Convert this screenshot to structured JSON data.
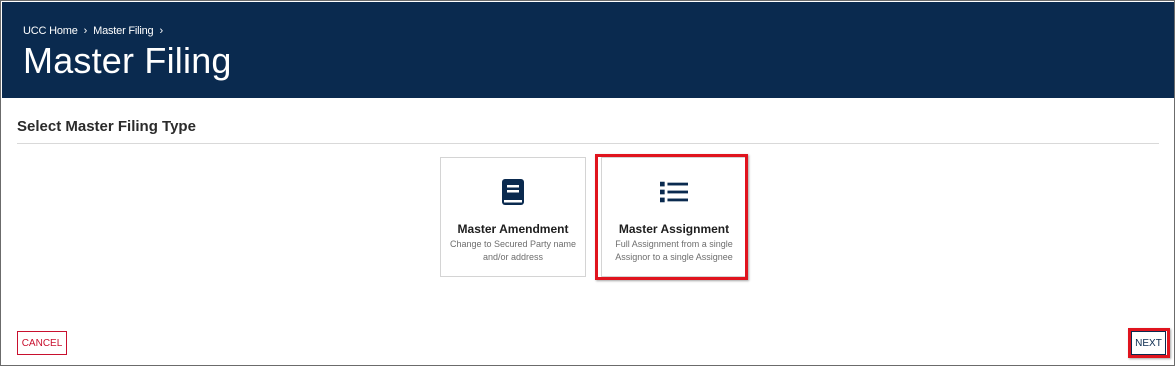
{
  "header": {
    "breadcrumb": [
      {
        "label": "UCC Home"
      },
      {
        "label": "Master Filing"
      }
    ],
    "title": "Master Filing"
  },
  "section": {
    "title": "Select Master Filing Type"
  },
  "cards": [
    {
      "icon": "book-icon",
      "title": "Master Amendment",
      "description": "Change to Secured Party name and/or address"
    },
    {
      "icon": "list-icon",
      "title": "Master Assignment",
      "description": "Full Assignment from a single Assignor to a single Assignee"
    }
  ],
  "actions": {
    "cancel_label": "CANCEL",
    "next_label": "NEXT"
  },
  "colors": {
    "header_bg": "#0a2a4f",
    "cancel": "#c8102e",
    "highlight": "#e0141e"
  }
}
